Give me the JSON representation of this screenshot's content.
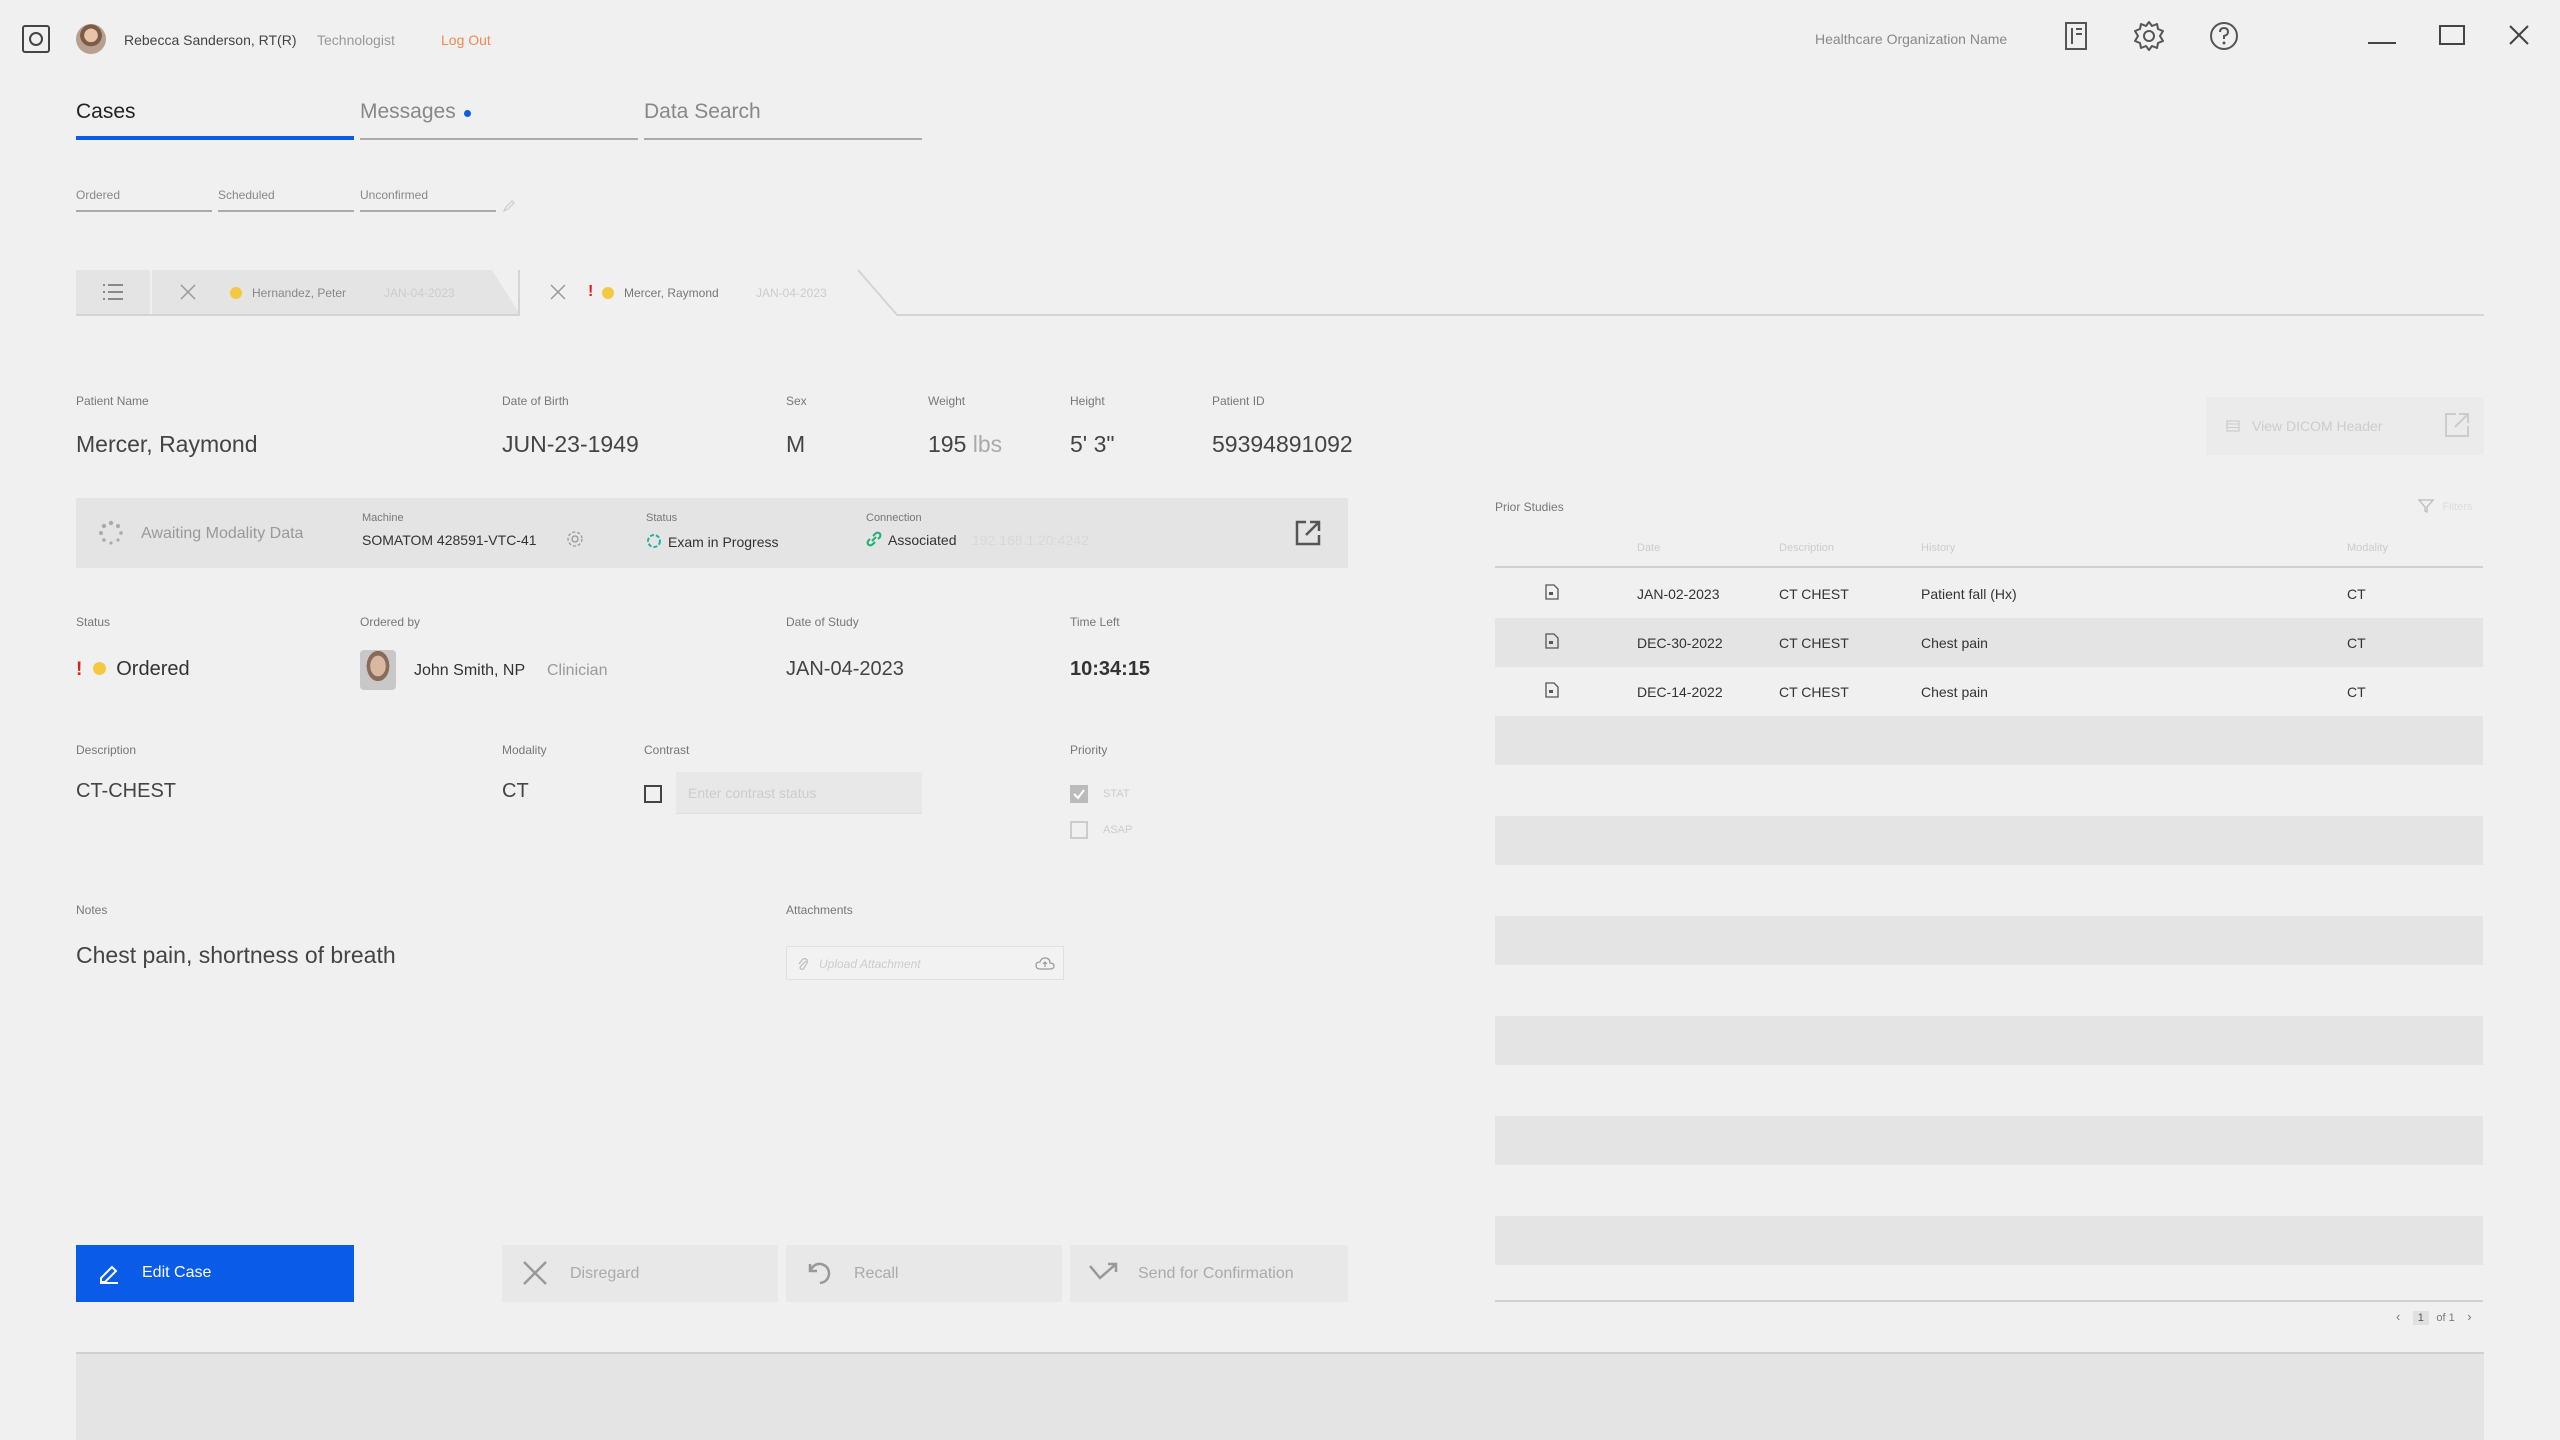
{
  "app": {
    "user_name": "Rebecca Sanderson, RT(R)",
    "user_role": "Technologist",
    "logout": "Log Out",
    "org_name": "Healthcare Organization Name"
  },
  "main_tabs": [
    {
      "label": "Cases",
      "active": true
    },
    {
      "label": "Messages",
      "has_dot": true
    },
    {
      "label": "Data Search"
    }
  ],
  "sub_tabs": [
    "Ordered",
    "Scheduled",
    "Unconfirmed"
  ],
  "case_tabs": [
    {
      "name": "Hernandez, Peter",
      "date": "JAN-04-2023"
    },
    {
      "name": "Mercer, Raymond",
      "date": "JAN-04-2023",
      "urgent": "!"
    }
  ],
  "patient": {
    "labels": {
      "name": "Patient Name",
      "dob": "Date of Birth",
      "sex": "Sex",
      "weight": "Weight",
      "height": "Height",
      "id": "Patient ID"
    },
    "name": "Mercer, Raymond",
    "dob": "JUN-23-1949",
    "sex": "M",
    "weight": "195",
    "weight_unit": "lbs",
    "height": "5' 3\"",
    "id": "59394891092",
    "dicom_button": "View DICOM Header"
  },
  "modality_bar": {
    "awaiting": "Awaiting Modality Data",
    "machine_label": "Machine",
    "machine": "SOMATOM 428591-VTC-41",
    "status_label": "Status",
    "status": "Exam in Progress",
    "connection_label": "Connection",
    "connection": "Associated",
    "ip": "192.168.1.20:4242"
  },
  "order": {
    "labels": {
      "status": "Status",
      "ordered_by": "Ordered by",
      "date_of_study": "Date of Study",
      "time_left": "Time Left"
    },
    "urgent": "!",
    "status": "Ordered",
    "ordered_by": "John Smith, NP",
    "ordered_by_role": "Clinician",
    "date_of_study": "JAN-04-2023",
    "time_left": "10:34:15"
  },
  "exam": {
    "labels": {
      "description": "Description",
      "modality": "Modality",
      "contrast": "Contrast",
      "priority": "Priority"
    },
    "description": "CT-CHEST",
    "modality": "CT",
    "contrast_placeholder": "Enter contrast status",
    "priority_options": [
      {
        "label": "STAT",
        "checked": true
      },
      {
        "label": "ASAP",
        "checked": false
      }
    ]
  },
  "notes": {
    "label": "Notes",
    "text": "Chest pain, shortness of breath",
    "attachments_label": "Attachments",
    "upload_placeholder": "Upload Attachment"
  },
  "actions": {
    "edit": "Edit Case",
    "disregard": "Disregard",
    "recall": "Recall",
    "send": "Send for Confirmation"
  },
  "prior_studies": {
    "title": "Prior Studies",
    "filters": "Filters",
    "columns": [
      "Date",
      "Description",
      "History",
      "Modality"
    ],
    "rows": [
      {
        "date": "JAN-02-2023",
        "description": "CT CHEST",
        "history": "Patient fall (Hx)",
        "modality": "CT"
      },
      {
        "date": "DEC-30-2022",
        "description": "CT CHEST",
        "history": "Chest pain",
        "modality": "CT"
      },
      {
        "date": "DEC-14-2022",
        "description": "CT CHEST",
        "history": "Chest pain",
        "modality": "CT"
      }
    ],
    "pagination": {
      "page": "1",
      "of": "of 1"
    }
  },
  "colors": {
    "accent": "#0a5ce8",
    "logout": "#f08a50",
    "urgent": "#e02020",
    "status_yellow": "#f5c842",
    "connection_green": "#20b070"
  }
}
